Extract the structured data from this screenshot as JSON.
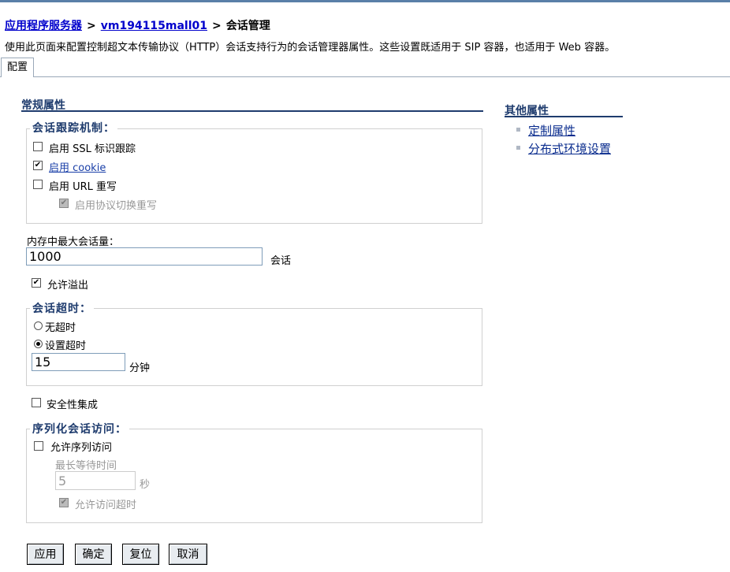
{
  "breadcrumb": {
    "root": "应用程序服务器",
    "server": "vm194115mall01",
    "current": "会话管理"
  },
  "description": "使用此页面来配置控制超文本传输协议（HTTP）会话支持行为的会话管理器属性。这些设置既适用于 SIP 容器，也适用于 Web 容器。",
  "tabs": [
    {
      "label": "配置",
      "active": true
    }
  ],
  "general": {
    "title": "常规属性",
    "tracking": {
      "legend": "会话跟踪机制：",
      "ssl": {
        "label": "启用 SSL 标识跟踪",
        "checked": false
      },
      "cookie": {
        "label": "启用 cookie",
        "checked": true
      },
      "url": {
        "label": "启用 URL 重写",
        "checked": false
      },
      "protocol": {
        "label": "启用协议切换重写",
        "checked": true,
        "disabled": true
      }
    },
    "max_sessions": {
      "label": "内存中最大会话量：",
      "value": "1000",
      "unit": "会话"
    },
    "overflow": {
      "label": "允许溢出",
      "checked": true
    },
    "timeout": {
      "legend": "会话超时：",
      "none": {
        "label": "无超时",
        "selected": false
      },
      "set": {
        "label": "设置超时",
        "selected": true
      },
      "value": "15",
      "unit": "分钟"
    },
    "security": {
      "label": "安全性集成",
      "checked": false
    },
    "serial": {
      "legend": "序列化会话访问：",
      "allow": {
        "label": "允许序列访问",
        "checked": false
      },
      "wait_label": "最长等待时间",
      "wait_value": "5",
      "wait_unit": "秒",
      "allow_timeout": {
        "label": "允许访问超时",
        "checked": true,
        "disabled": true
      }
    }
  },
  "other": {
    "title": "其他属性",
    "links": [
      "定制属性",
      "分布式环境设置"
    ]
  },
  "buttons": {
    "apply": "应用",
    "ok": "确定",
    "reset": "复位",
    "cancel": "取消"
  }
}
